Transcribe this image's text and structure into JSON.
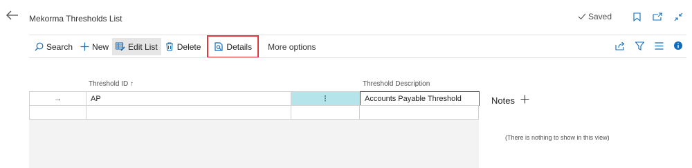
{
  "page": {
    "title": "Mekorma Thresholds List",
    "status": "Saved"
  },
  "actions": {
    "search": "Search",
    "new": "New",
    "edit_list": "Edit List",
    "delete": "Delete",
    "details": "Details",
    "more_options": "More options"
  },
  "grid": {
    "columns": {
      "threshold_id": "Threshold ID ↑",
      "threshold_description": "Threshold Description"
    },
    "rows": [
      {
        "arrow": "→",
        "threshold_id": "AP",
        "menu": "⋮",
        "description": "Accounts Payable Threshold"
      }
    ]
  },
  "notes": {
    "title": "Notes",
    "empty_text": "(There is nothing to show in this view)"
  },
  "colors": {
    "selected_cell": "#b5e5ea",
    "highlight_box": "#e0383c",
    "accent": "#0f6cbd"
  }
}
